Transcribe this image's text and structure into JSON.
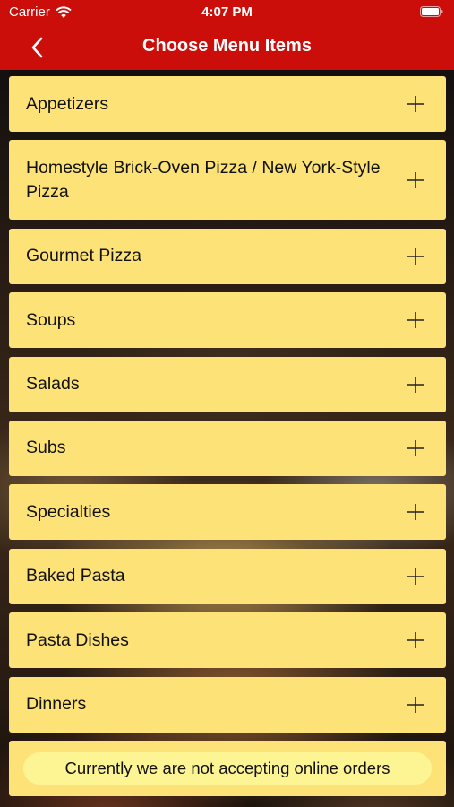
{
  "status_bar": {
    "carrier": "Carrier",
    "time": "4:07 PM"
  },
  "nav": {
    "title": "Choose Menu Items"
  },
  "menu_items": [
    {
      "label": "Appetizers"
    },
    {
      "label": "Homestyle Brick-Oven Pizza / New York-Style Pizza"
    },
    {
      "label": "Gourmet Pizza"
    },
    {
      "label": "Soups"
    },
    {
      "label": "Salads"
    },
    {
      "label": "Subs"
    },
    {
      "label": "Specialties"
    },
    {
      "label": "Baked Pasta"
    },
    {
      "label": "Pasta Dishes"
    },
    {
      "label": "Dinners"
    },
    {
      "label": ""
    }
  ],
  "toast": {
    "message": "Currently we are not accepting online orders"
  },
  "colors": {
    "header": "#cc0e0a",
    "item_background": "#fde278",
    "toast_background": "#fdf594"
  },
  "icons": {
    "back": "chevron-left-icon",
    "expand": "plus-icon",
    "wifi": "wifi-icon",
    "battery": "battery-icon"
  }
}
